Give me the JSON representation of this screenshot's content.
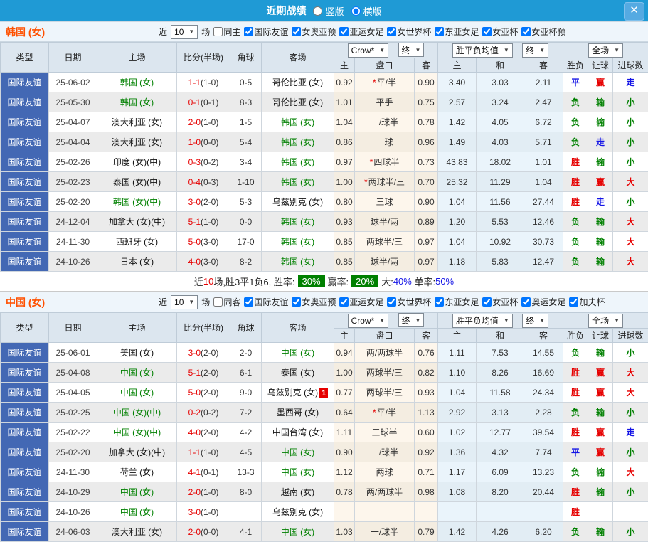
{
  "titlebar": {
    "title": "近期战绩",
    "options": [
      {
        "label": "竖版",
        "selected": false
      },
      {
        "label": "横版",
        "selected": true
      }
    ],
    "close_label": "✕"
  },
  "headers": {
    "type": "类型",
    "date": "日期",
    "home": "主场",
    "score": "比分(半场)",
    "corner": "角球",
    "away": "客场",
    "crow_select": "Crow*",
    "final_select_1": "终",
    "avg_select": "胜平负均值",
    "final_select_2": "终",
    "full_select": "全场",
    "subs": [
      "主",
      "盘口",
      "客",
      "主",
      "和",
      "客",
      "胜负",
      "让球",
      "进球数"
    ]
  },
  "filter_common": {
    "near": "近",
    "count": "10",
    "matches": "场"
  },
  "colors": {
    "accent_blue": "#1f9ad5",
    "league_blue": "#4368b4",
    "team_green": "#008000",
    "score_red": "#e60000",
    "rate_badge_green": "#008000",
    "section_title_orange": "#ff5000"
  },
  "sections": [
    {
      "team": "韩国 (女)",
      "count": "10",
      "same_label": "同主",
      "same_checked": false,
      "competitions": [
        {
          "label": "国际友谊",
          "checked": true
        },
        {
          "label": "女奥亚预",
          "checked": true
        },
        {
          "label": "亚运女足",
          "checked": true
        },
        {
          "label": "女世界杯",
          "checked": true
        },
        {
          "label": "东亚女足",
          "checked": true
        },
        {
          "label": "女亚杯",
          "checked": true
        },
        {
          "label": "女亚杯预",
          "checked": true
        }
      ],
      "rows": [
        {
          "type": "国际友谊",
          "date": "25-06-02",
          "home": "韩国 (女)",
          "home_hl": true,
          "score": "1-1",
          "half": "(1-0)",
          "corner": "0-5",
          "away": "哥伦比亚 (女)",
          "away_hl": false,
          "away_badge": "",
          "w1": "0.92",
          "plate": "*平/半",
          "w2": "0.90",
          "m1": "3.40",
          "m2": "3.03",
          "m3": "2.11",
          "r1": "平",
          "r2": "赢",
          "r3": "走"
        },
        {
          "type": "国际友谊",
          "date": "25-05-30",
          "home": "韩国 (女)",
          "home_hl": true,
          "score": "0-1",
          "half": "(0-1)",
          "corner": "8-3",
          "away": "哥伦比亚 (女)",
          "away_hl": false,
          "away_badge": "",
          "w1": "1.01",
          "plate": "平手",
          "w2": "0.75",
          "m1": "2.57",
          "m2": "3.24",
          "m3": "2.47",
          "r1": "负",
          "r2": "输",
          "r3": "小"
        },
        {
          "type": "国际友谊",
          "date": "25-04-07",
          "home": "澳大利亚 (女)",
          "home_hl": false,
          "score": "2-0",
          "half": "(1-0)",
          "corner": "1-5",
          "away": "韩国 (女)",
          "away_hl": true,
          "away_badge": "",
          "w1": "1.04",
          "plate": "一/球半",
          "w2": "0.78",
          "m1": "1.42",
          "m2": "4.05",
          "m3": "6.72",
          "r1": "负",
          "r2": "输",
          "r3": "小"
        },
        {
          "type": "国际友谊",
          "date": "25-04-04",
          "home": "澳大利亚 (女)",
          "home_hl": false,
          "score": "1-0",
          "half": "(0-0)",
          "corner": "5-4",
          "away": "韩国 (女)",
          "away_hl": true,
          "away_badge": "",
          "w1": "0.86",
          "plate": "一球",
          "w2": "0.96",
          "m1": "1.49",
          "m2": "4.03",
          "m3": "5.71",
          "r1": "负",
          "r2": "走",
          "r3": "小"
        },
        {
          "type": "国际友谊",
          "date": "25-02-26",
          "home": "印度 (女)(中)",
          "home_hl": false,
          "score": "0-3",
          "half": "(0-2)",
          "corner": "3-4",
          "away": "韩国 (女)",
          "away_hl": true,
          "away_badge": "",
          "w1": "0.97",
          "plate": "*四球半",
          "w2": "0.73",
          "m1": "43.83",
          "m2": "18.02",
          "m3": "1.01",
          "r1": "胜",
          "r2": "输",
          "r3": "小"
        },
        {
          "type": "国际友谊",
          "date": "25-02-23",
          "home": "泰国 (女)(中)",
          "home_hl": false,
          "score": "0-4",
          "half": "(0-3)",
          "corner": "1-10",
          "away": "韩国 (女)",
          "away_hl": true,
          "away_badge": "",
          "w1": "1.00",
          "plate": "*两球半/三",
          "w2": "0.70",
          "m1": "25.32",
          "m2": "11.29",
          "m3": "1.04",
          "r1": "胜",
          "r2": "赢",
          "r3": "大"
        },
        {
          "type": "国际友谊",
          "date": "25-02-20",
          "home": "韩国 (女)(中)",
          "home_hl": true,
          "score": "3-0",
          "half": "(2-0)",
          "corner": "5-3",
          "away": "乌兹别克 (女)",
          "away_hl": false,
          "away_badge": "",
          "w1": "0.80",
          "plate": "三球",
          "w2": "0.90",
          "m1": "1.04",
          "m2": "11.56",
          "m3": "27.44",
          "r1": "胜",
          "r2": "走",
          "r3": "小"
        },
        {
          "type": "国际友谊",
          "date": "24-12-04",
          "home": "加拿大 (女)(中)",
          "home_hl": false,
          "score": "5-1",
          "half": "(1-0)",
          "corner": "0-0",
          "away": "韩国 (女)",
          "away_hl": true,
          "away_badge": "",
          "w1": "0.93",
          "plate": "球半/两",
          "w2": "0.89",
          "m1": "1.20",
          "m2": "5.53",
          "m3": "12.46",
          "r1": "负",
          "r2": "输",
          "r3": "大"
        },
        {
          "type": "国际友谊",
          "date": "24-11-30",
          "home": "西班牙 (女)",
          "home_hl": false,
          "score": "5-0",
          "half": "(3-0)",
          "corner": "17-0",
          "away": "韩国 (女)",
          "away_hl": true,
          "away_badge": "",
          "w1": "0.85",
          "plate": "两球半/三",
          "w2": "0.97",
          "m1": "1.04",
          "m2": "10.92",
          "m3": "30.73",
          "r1": "负",
          "r2": "输",
          "r3": "大"
        },
        {
          "type": "国际友谊",
          "date": "24-10-26",
          "home": "日本 (女)",
          "home_hl": false,
          "score": "4-0",
          "half": "(3-0)",
          "corner": "8-2",
          "away": "韩国 (女)",
          "away_hl": true,
          "away_badge": "",
          "w1": "0.85",
          "plate": "球半/两",
          "w2": "0.97",
          "m1": "1.18",
          "m2": "5.83",
          "m3": "12.47",
          "r1": "负",
          "r2": "输",
          "r3": "大"
        }
      ],
      "summary": {
        "pre": "近",
        "num": "10",
        "seg1": "场,胜3平1负6, 胜率:",
        "rate1": "30%",
        "seg2": "赢率:",
        "rate2": "20%",
        "seg3": "大:",
        "pct1": "40%",
        "seg4": "单率:",
        "pct2": "50%"
      }
    },
    {
      "team": "中国 (女)",
      "count": "10",
      "same_label": "同客",
      "same_checked": false,
      "competitions": [
        {
          "label": "国际友谊",
          "checked": true
        },
        {
          "label": "女奥亚预",
          "checked": true
        },
        {
          "label": "亚运女足",
          "checked": true
        },
        {
          "label": "女世界杯",
          "checked": true
        },
        {
          "label": "东亚女足",
          "checked": true
        },
        {
          "label": "女亚杯",
          "checked": true
        },
        {
          "label": "奥运女足",
          "checked": true
        },
        {
          "label": "加夫杯",
          "checked": true
        }
      ],
      "rows": [
        {
          "type": "国际友谊",
          "date": "25-06-01",
          "home": "美国 (女)",
          "home_hl": false,
          "score": "3-0",
          "half": "(2-0)",
          "corner": "2-0",
          "away": "中国 (女)",
          "away_hl": true,
          "away_badge": "",
          "w1": "0.94",
          "plate": "两/两球半",
          "w2": "0.76",
          "m1": "1.11",
          "m2": "7.53",
          "m3": "14.55",
          "r1": "负",
          "r2": "输",
          "r3": "小"
        },
        {
          "type": "国际友谊",
          "date": "25-04-08",
          "home": "中国 (女)",
          "home_hl": true,
          "score": "5-1",
          "half": "(2-0)",
          "corner": "6-1",
          "away": "泰国 (女)",
          "away_hl": false,
          "away_badge": "",
          "w1": "1.00",
          "plate": "两球半/三",
          "w2": "0.82",
          "m1": "1.10",
          "m2": "8.26",
          "m3": "16.69",
          "r1": "胜",
          "r2": "赢",
          "r3": "大"
        },
        {
          "type": "国际友谊",
          "date": "25-04-05",
          "home": "中国 (女)",
          "home_hl": true,
          "score": "5-0",
          "half": "(2-0)",
          "corner": "9-0",
          "away": "乌兹别克 (女)",
          "away_hl": false,
          "away_badge": "1",
          "w1": "0.77",
          "plate": "两球半/三",
          "w2": "0.93",
          "m1": "1.04",
          "m2": "11.58",
          "m3": "24.34",
          "r1": "胜",
          "r2": "赢",
          "r3": "大"
        },
        {
          "type": "国际友谊",
          "date": "25-02-25",
          "home": "中国 (女)(中)",
          "home_hl": true,
          "score": "0-2",
          "half": "(0-2)",
          "corner": "7-2",
          "away": "墨西哥 (女)",
          "away_hl": false,
          "away_badge": "",
          "w1": "0.64",
          "plate": "*平/半",
          "w2": "1.13",
          "m1": "2.92",
          "m2": "3.13",
          "m3": "2.28",
          "r1": "负",
          "r2": "输",
          "r3": "小"
        },
        {
          "type": "国际友谊",
          "date": "25-02-22",
          "home": "中国 (女)(中)",
          "home_hl": true,
          "score": "4-0",
          "half": "(2-0)",
          "corner": "4-2",
          "away": "中国台湾 (女)",
          "away_hl": false,
          "away_badge": "",
          "w1": "1.11",
          "plate": "三球半",
          "w2": "0.60",
          "m1": "1.02",
          "m2": "12.77",
          "m3": "39.54",
          "r1": "胜",
          "r2": "赢",
          "r3": "走"
        },
        {
          "type": "国际友谊",
          "date": "25-02-20",
          "home": "加拿大 (女)(中)",
          "home_hl": false,
          "score": "1-1",
          "half": "(1-0)",
          "corner": "4-5",
          "away": "中国 (女)",
          "away_hl": true,
          "away_badge": "",
          "w1": "0.90",
          "plate": "一/球半",
          "w2": "0.92",
          "m1": "1.36",
          "m2": "4.32",
          "m3": "7.74",
          "r1": "平",
          "r2": "赢",
          "r3": "小"
        },
        {
          "type": "国际友谊",
          "date": "24-11-30",
          "home": "荷兰 (女)",
          "home_hl": false,
          "score": "4-1",
          "half": "(0-1)",
          "corner": "13-3",
          "away": "中国 (女)",
          "away_hl": true,
          "away_badge": "",
          "w1": "1.12",
          "plate": "两球",
          "w2": "0.71",
          "m1": "1.17",
          "m2": "6.09",
          "m3": "13.23",
          "r1": "负",
          "r2": "输",
          "r3": "大"
        },
        {
          "type": "国际友谊",
          "date": "24-10-29",
          "home": "中国 (女)",
          "home_hl": true,
          "score": "2-0",
          "half": "(1-0)",
          "corner": "8-0",
          "away": "越南 (女)",
          "away_hl": false,
          "away_badge": "",
          "w1": "0.78",
          "plate": "两/两球半",
          "w2": "0.98",
          "m1": "1.08",
          "m2": "8.20",
          "m3": "20.44",
          "r1": "胜",
          "r2": "输",
          "r3": "小"
        },
        {
          "type": "国际友谊",
          "date": "24-10-26",
          "home": "中国 (女)",
          "home_hl": true,
          "score": "3-0",
          "half": "(1-0)",
          "corner": "",
          "away": "乌兹别克 (女)",
          "away_hl": false,
          "away_badge": "",
          "w1": "",
          "plate": "",
          "w2": "",
          "m1": "",
          "m2": "",
          "m3": "",
          "r1": "胜",
          "r2": "",
          "r3": ""
        },
        {
          "type": "国际友谊",
          "date": "24-06-03",
          "home": "澳大利亚 (女)",
          "home_hl": false,
          "score": "2-0",
          "half": "(0-0)",
          "corner": "4-1",
          "away": "中国 (女)",
          "away_hl": true,
          "away_badge": "",
          "w1": "1.03",
          "plate": "一/球半",
          "w2": "0.79",
          "m1": "1.42",
          "m2": "4.26",
          "m3": "6.20",
          "r1": "负",
          "r2": "输",
          "r3": "小"
        }
      ],
      "summary": null
    }
  ]
}
